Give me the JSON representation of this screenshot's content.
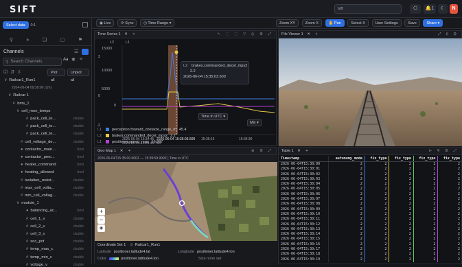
{
  "app": {
    "logo": "SIFT",
    "search_value": "sift"
  },
  "toolbar": {
    "live": "Live",
    "sync": "Sync",
    "time_range": "Time Range",
    "zoom_xy": "Zoom XY",
    "zoom_x": "Zoom X",
    "pan": "Pan",
    "select_x": "Select X",
    "user_settings": "User Settings",
    "save": "Save",
    "share": "Share",
    "notif_count": "1",
    "avatar": "N"
  },
  "sidebar": {
    "select_data": "Select data",
    "count": "0:1",
    "channels_title": "Channels",
    "search_placeholder": "Search Channels",
    "aa": "Aa",
    "plot_all": "Plot all",
    "unplot_all": "Unplot all",
    "items": [
      {
        "label": "Railcar1_Run1",
        "type": ""
      },
      {
        "label": "2024-06-04 09:30:00 (1m)",
        "type": ""
      },
      {
        "label": "Railcar 1",
        "type": ""
      },
      {
        "label": "bms_1",
        "type": ""
      },
      {
        "label": "cell_mon_temps",
        "type": ""
      },
      {
        "label": "pack_cell_te...",
        "type": "double"
      },
      {
        "label": "pack_cell_te...",
        "type": "double"
      },
      {
        "label": "pack_cell_te...",
        "type": "double"
      },
      {
        "label": "cell_voltage_de...",
        "type": "double"
      },
      {
        "label": "contactor_main...",
        "type": "bool"
      },
      {
        "label": "contactor_prec...",
        "type": "bool"
      },
      {
        "label": "heater_command",
        "type": "bool"
      },
      {
        "label": "heating_allowed",
        "type": "bool"
      },
      {
        "label": "isolation_resist...",
        "type": "double"
      },
      {
        "label": "max_cell_volta...",
        "type": "double"
      },
      {
        "label": "min_cell_voltag...",
        "type": "double"
      },
      {
        "label": "module_1",
        "type": ""
      },
      {
        "label": "balancing_ac...",
        "type": "bool"
      },
      {
        "label": "cell_1_v",
        "type": "double"
      },
      {
        "label": "cell_2_v",
        "type": "double"
      },
      {
        "label": "cell_3_v",
        "type": "double"
      },
      {
        "label": "soc_pct",
        "type": "double"
      },
      {
        "label": "temp_max_c",
        "type": "double"
      },
      {
        "label": "temp_min_c",
        "type": "double"
      },
      {
        "label": "voltage_v",
        "type": "double"
      }
    ]
  },
  "timeseries": {
    "tab": "Time Series 1",
    "l2": "L2",
    "l1": "L1",
    "ymax": "15000",
    "y1": "10000",
    "y2": "5000",
    "y3": "0",
    "r1": "2",
    "r2": "0",
    "r3": "-2",
    "x0": "2026-06-04 15:34:45",
    "x1": "2026-06-04 15:34:45.763",
    "x2": "2026-06-04 15:35:03.600",
    "x3": "15:35:15",
    "x4": "15:35:30",
    "tooltip_name": "brakes.commanded_decel_mps2",
    "tooltip_value": "2.2",
    "tooltip_time": "2026-06-04 15:35:03.600",
    "time_in": "Time in UTC",
    "mix": "Mix",
    "legend": [
      {
        "axis": "L1",
        "name": "perception.forward_obstacle_range_m",
        "value": "45.4",
        "color": "#3f7de8"
      },
      {
        "axis": "L2",
        "name": "brakes.commanded_decel_mps2",
        "value": "2.2",
        "color": "#e6c84a"
      },
      {
        "axis": "L1",
        "name": "positioner.speed_mps",
        "value": "16.387",
        "color": "#b43fd8"
      }
    ]
  },
  "fileviewer": {
    "tab": "File Viewer 1"
  },
  "geomap": {
    "tab": "Geo Map 1",
    "timebar": "2026-06-04T15:35:00.000Z — 15:39:59.999Z | Time in UTC",
    "zoom_in": "+",
    "zoom_out": "−",
    "coord_set": "Coordinate Set 1",
    "run": "Railcar1_Run1",
    "lat_label": "Latitude",
    "lat_value": "positioner.latitude4.lat",
    "lon_label": "Longitude",
    "lon_value": "positioner.latitude4.lon",
    "color_label": "Color",
    "color_value": "positioner.latitude4.lon",
    "size_label": "Size none set"
  },
  "table": {
    "tab": "Table 1",
    "columns": [
      "Timestamp",
      "autonomy_mode",
      "fix_type",
      "fix_type",
      "fix_type",
      "fix_type"
    ],
    "rows": [
      [
        "2026-06-04T15:30:00",
        "2",
        "2",
        "2",
        "2",
        "2"
      ],
      [
        "2026-06-04T15:30:01",
        "2",
        "2",
        "2",
        "2",
        "2"
      ],
      [
        "2026-06-04T15:30:02",
        "2",
        "2",
        "2",
        "2",
        "2"
      ],
      [
        "2026-06-04T15:30:03",
        "2",
        "2",
        "2",
        "2",
        "2"
      ],
      [
        "2026-06-04T15:30:04",
        "2",
        "2",
        "2",
        "2",
        "2"
      ],
      [
        "2026-06-04T15:30:05",
        "2",
        "2",
        "2",
        "2",
        "2"
      ],
      [
        "2026-06-04T15:30:06",
        "2",
        "2",
        "2",
        "2",
        "2"
      ],
      [
        "2026-06-04T15:30:07",
        "2",
        "2",
        "2",
        "2",
        "2"
      ],
      [
        "2026-06-04T15:30:08",
        "2",
        "2",
        "2",
        "2",
        "2"
      ],
      [
        "2026-06-04T15:30:09",
        "2",
        "2",
        "2",
        "2",
        "2"
      ],
      [
        "2026-06-04T15:30:10",
        "2",
        "2",
        "2",
        "2",
        "2"
      ],
      [
        "2026-06-04T15:30:11",
        "2",
        "2",
        "2",
        "2",
        "2"
      ],
      [
        "2026-06-04T15:30:12",
        "2",
        "2",
        "2",
        "2",
        "2"
      ],
      [
        "2026-06-04T15:30:13",
        "2",
        "2",
        "2",
        "2",
        "2"
      ],
      [
        "2026-06-04T15:30:14",
        "2",
        "2",
        "2",
        "2",
        "2"
      ],
      [
        "2026-06-04T15:30:15",
        "2",
        "2",
        "2",
        "2",
        "2"
      ],
      [
        "2026-06-04T15:30:16",
        "2",
        "2",
        "2",
        "2",
        "2"
      ],
      [
        "2026-06-04T15:30:17",
        "2",
        "2",
        "2",
        "2",
        "2"
      ],
      [
        "2026-06-04T15:30:18",
        "2",
        "2",
        "2",
        "2",
        "2"
      ],
      [
        "2026-06-04T15:30:19",
        "2",
        "2",
        "2",
        "2",
        "2"
      ]
    ]
  }
}
